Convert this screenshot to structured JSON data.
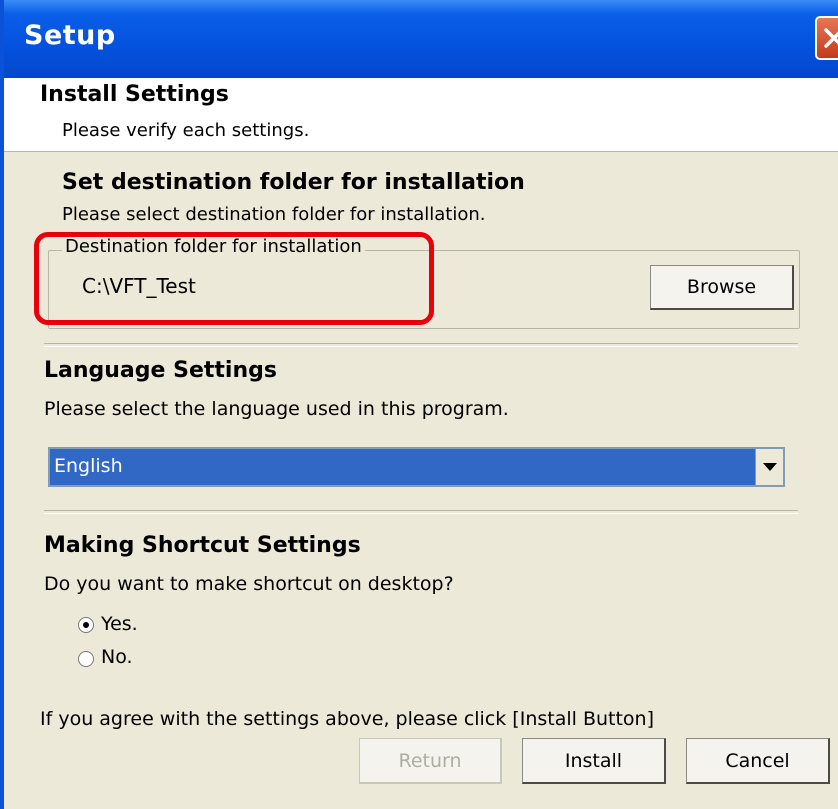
{
  "window": {
    "title": "Setup"
  },
  "header": {
    "title": "Install Settings",
    "subtitle": "Please verify each settings."
  },
  "destination": {
    "title": "Set destination folder for installation",
    "description": "Please select destination folder for installation.",
    "group_label": "Destination folder for installation",
    "folder_path": "C:\\VFT_Test",
    "browse_label": "Browse"
  },
  "language": {
    "title": "Language Settings",
    "description": "Please select the language used in this program.",
    "selected": "English"
  },
  "shortcut": {
    "title": "Making Shortcut Settings",
    "question": "Do you want to make shortcut on desktop?",
    "options": [
      {
        "label": "Yes.",
        "checked": true
      },
      {
        "label": "No.",
        "checked": false
      }
    ]
  },
  "footer": {
    "message": "If you agree with the settings above, please click [Install Button]",
    "return_label": "Return",
    "install_label": "Install",
    "cancel_label": "Cancel"
  },
  "colors": {
    "titlebar": "#0553e0",
    "highlight": "#e8000b",
    "selection": "#3168c5",
    "dialog_bg": "#ece9d8"
  },
  "icons": [
    "close-icon",
    "dropdown-arrow-icon"
  ]
}
